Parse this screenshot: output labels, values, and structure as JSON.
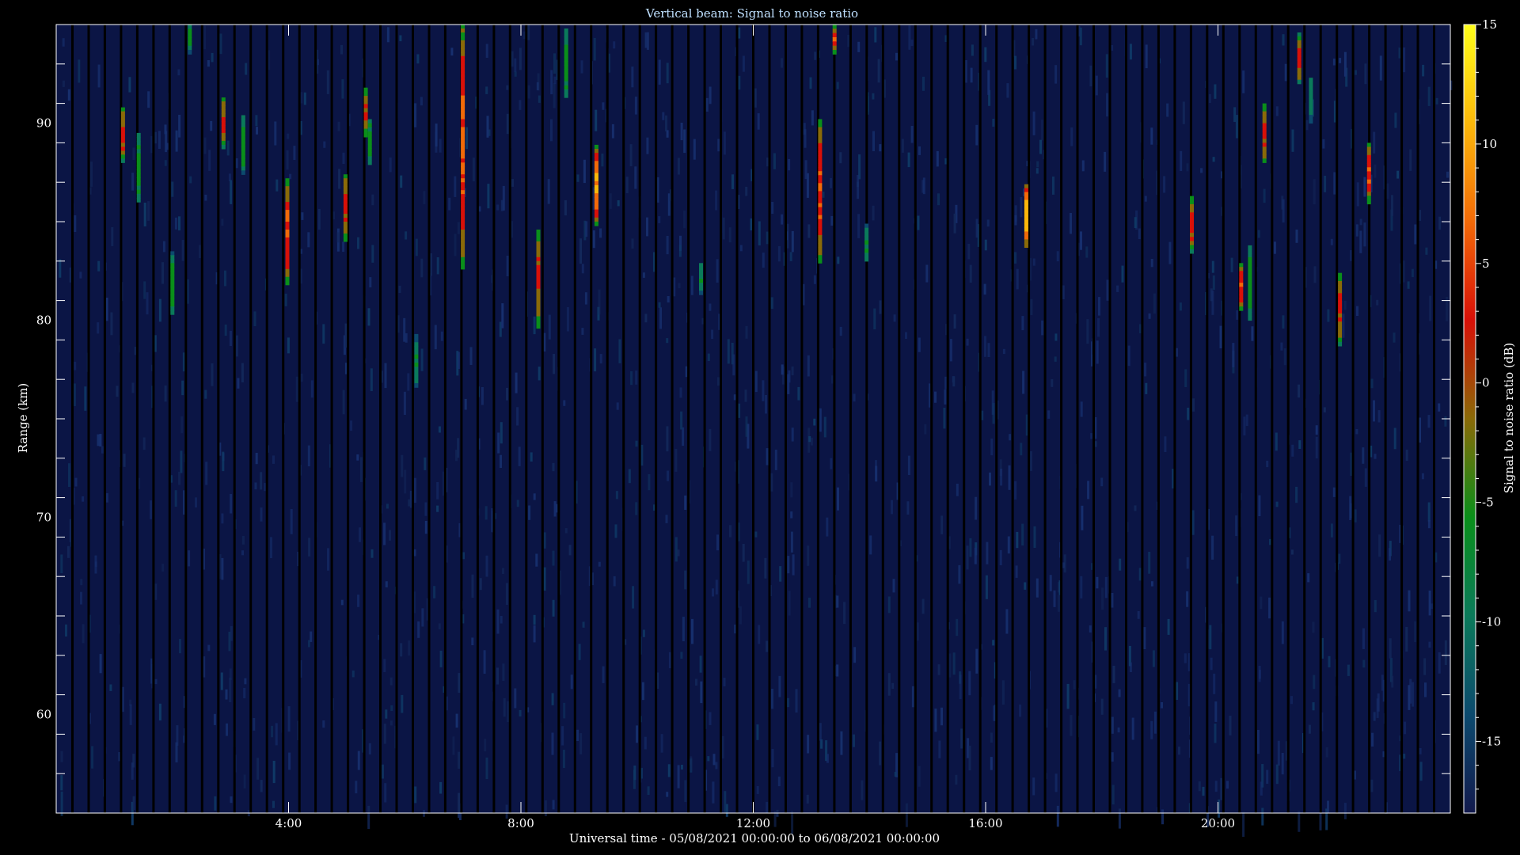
{
  "chart_data": {
    "type": "heatmap",
    "title": "Vertical beam: Signal to noise ratio",
    "xlabel": "Universal time - 05/08/2021 00:00:00 to 06/08/2021 00:00:00",
    "ylabel": "Range (km)",
    "colorbar_label": "Signal to noise ratio (dB)",
    "x_unit": "hours UT",
    "xlim": [
      0,
      24
    ],
    "ylim": [
      55,
      95
    ],
    "x_ticks": [
      4,
      8,
      12,
      16,
      20
    ],
    "x_tick_labels": [
      "4:00",
      "8:00",
      "12:00",
      "16:00",
      "20:00"
    ],
    "y_ticks": [
      60,
      70,
      80,
      90
    ],
    "y_tick_labels": [
      "60",
      "70",
      "80",
      "90"
    ],
    "colorbar_range": [
      -18,
      15
    ],
    "colorbar_ticks": [
      -15,
      -10,
      -5,
      0,
      5,
      10,
      15
    ],
    "colorbar_tick_labels": [
      "-15",
      "-10",
      "-5",
      "0",
      "5",
      "10",
      "15"
    ],
    "colormap": [
      "#131a4d",
      "#0c4a6e",
      "#0b7a5a",
      "#0a8f1a",
      "#8a6a08",
      "#d81008",
      "#f26a08",
      "#fbb80a",
      "#ffff1a"
    ],
    "background_color": "#0b1545",
    "gap_color": "#000000",
    "scan_gap_count": 86,
    "echoes": [
      {
        "t": 1.15,
        "r0": 88.0,
        "r1": 90.8,
        "peak_db": 2
      },
      {
        "t": 1.42,
        "r0": 86.0,
        "r1": 89.5,
        "peak_db": -5
      },
      {
        "t": 2.0,
        "r0": 80.3,
        "r1": 83.5,
        "peak_db": -5
      },
      {
        "t": 2.3,
        "r0": 93.5,
        "r1": 95.0,
        "peak_db": -5
      },
      {
        "t": 2.88,
        "r0": 88.7,
        "r1": 91.3,
        "peak_db": 2
      },
      {
        "t": 3.22,
        "r0": 87.4,
        "r1": 90.4,
        "peak_db": -5
      },
      {
        "t": 3.98,
        "r0": 81.8,
        "r1": 87.2,
        "peak_db": 5
      },
      {
        "t": 4.98,
        "r0": 84.0,
        "r1": 87.4,
        "peak_db": 2
      },
      {
        "t": 5.33,
        "r0": 89.3,
        "r1": 91.8,
        "peak_db": 2
      },
      {
        "t": 5.4,
        "r0": 87.9,
        "r1": 90.2,
        "peak_db": -5
      },
      {
        "t": 6.2,
        "r0": 76.6,
        "r1": 79.3,
        "peak_db": -8
      },
      {
        "t": 7.0,
        "r0": 82.6,
        "r1": 95.0,
        "peak_db": 6
      },
      {
        "t": 8.3,
        "r0": 79.6,
        "r1": 84.6,
        "peak_db": 2
      },
      {
        "t": 8.78,
        "r0": 91.3,
        "r1": 94.8,
        "peak_db": -5
      },
      {
        "t": 9.3,
        "r0": 84.8,
        "r1": 88.9,
        "peak_db": 9
      },
      {
        "t": 11.1,
        "r0": 81.3,
        "r1": 82.9,
        "peak_db": -8
      },
      {
        "t": 13.15,
        "r0": 82.9,
        "r1": 90.2,
        "peak_db": 5
      },
      {
        "t": 13.4,
        "r0": 93.5,
        "r1": 95.0,
        "peak_db": 4
      },
      {
        "t": 13.95,
        "r0": 83.0,
        "r1": 84.9,
        "peak_db": -8
      },
      {
        "t": 16.7,
        "r0": 83.7,
        "r1": 86.9,
        "peak_db": 12
      },
      {
        "t": 19.55,
        "r0": 83.4,
        "r1": 86.3,
        "peak_db": 2
      },
      {
        "t": 20.8,
        "r0": 88.0,
        "r1": 91.0,
        "peak_db": 2
      },
      {
        "t": 20.4,
        "r0": 80.5,
        "r1": 82.9,
        "peak_db": 5
      },
      {
        "t": 20.55,
        "r0": 80.0,
        "r1": 83.8,
        "peak_db": -5
      },
      {
        "t": 21.4,
        "r0": 92.0,
        "r1": 94.6,
        "peak_db": 2
      },
      {
        "t": 21.6,
        "r0": 90.0,
        "r1": 92.3,
        "peak_db": -8
      },
      {
        "t": 22.1,
        "r0": 78.7,
        "r1": 82.4,
        "peak_db": 2
      },
      {
        "t": 22.6,
        "r0": 85.9,
        "r1": 89.0,
        "peak_db": 5
      }
    ]
  }
}
